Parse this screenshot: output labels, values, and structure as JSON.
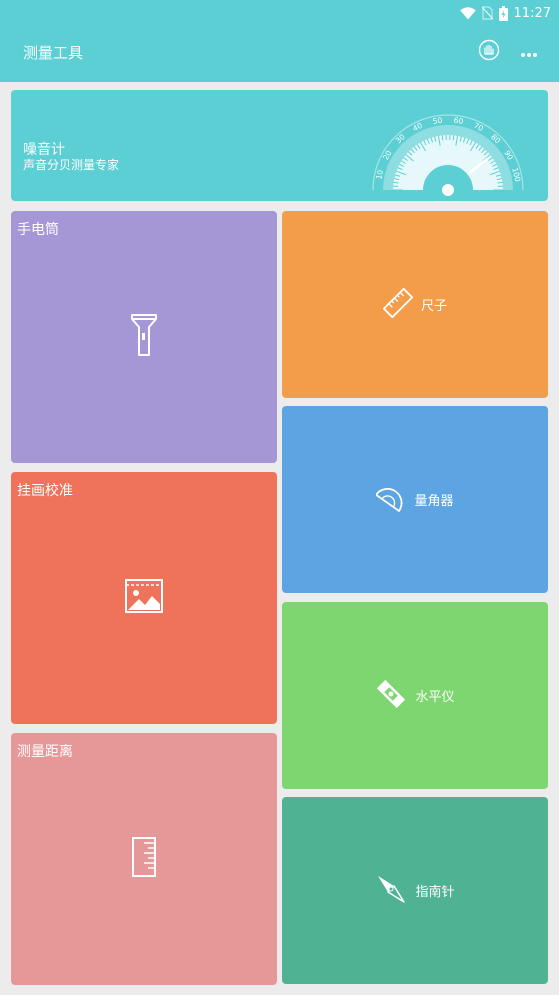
{
  "status_bar": {
    "time": "11:27"
  },
  "appbar": {
    "title": "测量工具"
  },
  "banner": {
    "title": "噪音计",
    "subtitle": "声音分贝测量专家",
    "gauge_ticks": [
      "10",
      "20",
      "30",
      "40",
      "50",
      "60",
      "70",
      "80",
      "90",
      "100"
    ]
  },
  "tiles": {
    "flashlight": {
      "label": "手电筒",
      "color": "#a597d6"
    },
    "picture": {
      "label": "挂画校准",
      "color": "#ef735b"
    },
    "distance": {
      "label": "测量距离",
      "color": "#e69898"
    },
    "ruler": {
      "label": "尺子",
      "color": "#f39d4b"
    },
    "protractor": {
      "label": "量角器",
      "color": "#5da4e2"
    },
    "level": {
      "label": "水平仪",
      "color": "#7dd66f"
    },
    "compass": {
      "label": "指南针",
      "color": "#4fb393"
    }
  }
}
